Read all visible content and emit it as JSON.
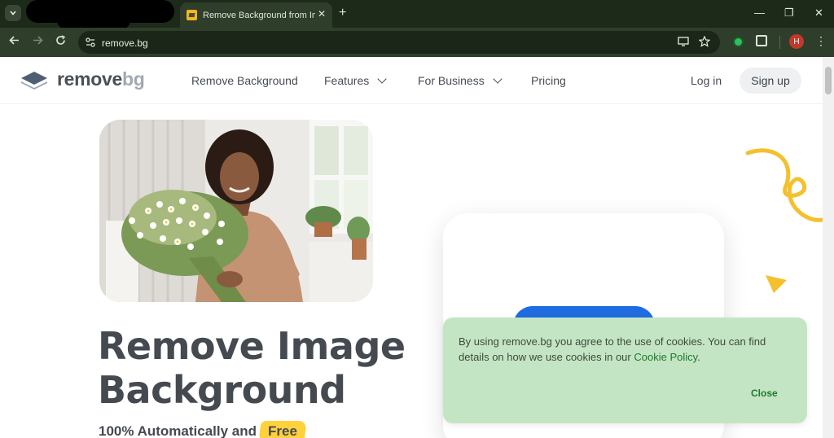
{
  "browser": {
    "tab_title": "Remove Background from Imag",
    "tab_close": "✕",
    "new_tab": "+",
    "url": "remove.bg",
    "window": {
      "minimize": "—",
      "restore": "❐",
      "close": "✕"
    },
    "profile_initial": "H"
  },
  "site": {
    "logo_main": "remove",
    "logo_accent": "bg",
    "nav": {
      "remove_background": "Remove Background",
      "features": "Features",
      "for_business": "For Business",
      "pricing": "Pricing"
    },
    "login": "Log in",
    "signup": "Sign up"
  },
  "hero": {
    "headline_line1": "Remove Image",
    "headline_line2": "Background",
    "subhead": "100% Automatically and",
    "subhead_highlight": "Free"
  },
  "cookie_banner": {
    "text_before": "By using remove.bg you agree to the use of cookies. You can find details on how we use cookies in our ",
    "link": "Cookie Policy",
    "text_after": ".",
    "close": "Close"
  },
  "colors": {
    "brand_text": "#4a5058",
    "primary_blue": "#1f6ce0",
    "cookie_bg": "#c4e5c4",
    "accent_yellow": "#f5c02d",
    "chrome_bg": "#1d2a1a"
  }
}
